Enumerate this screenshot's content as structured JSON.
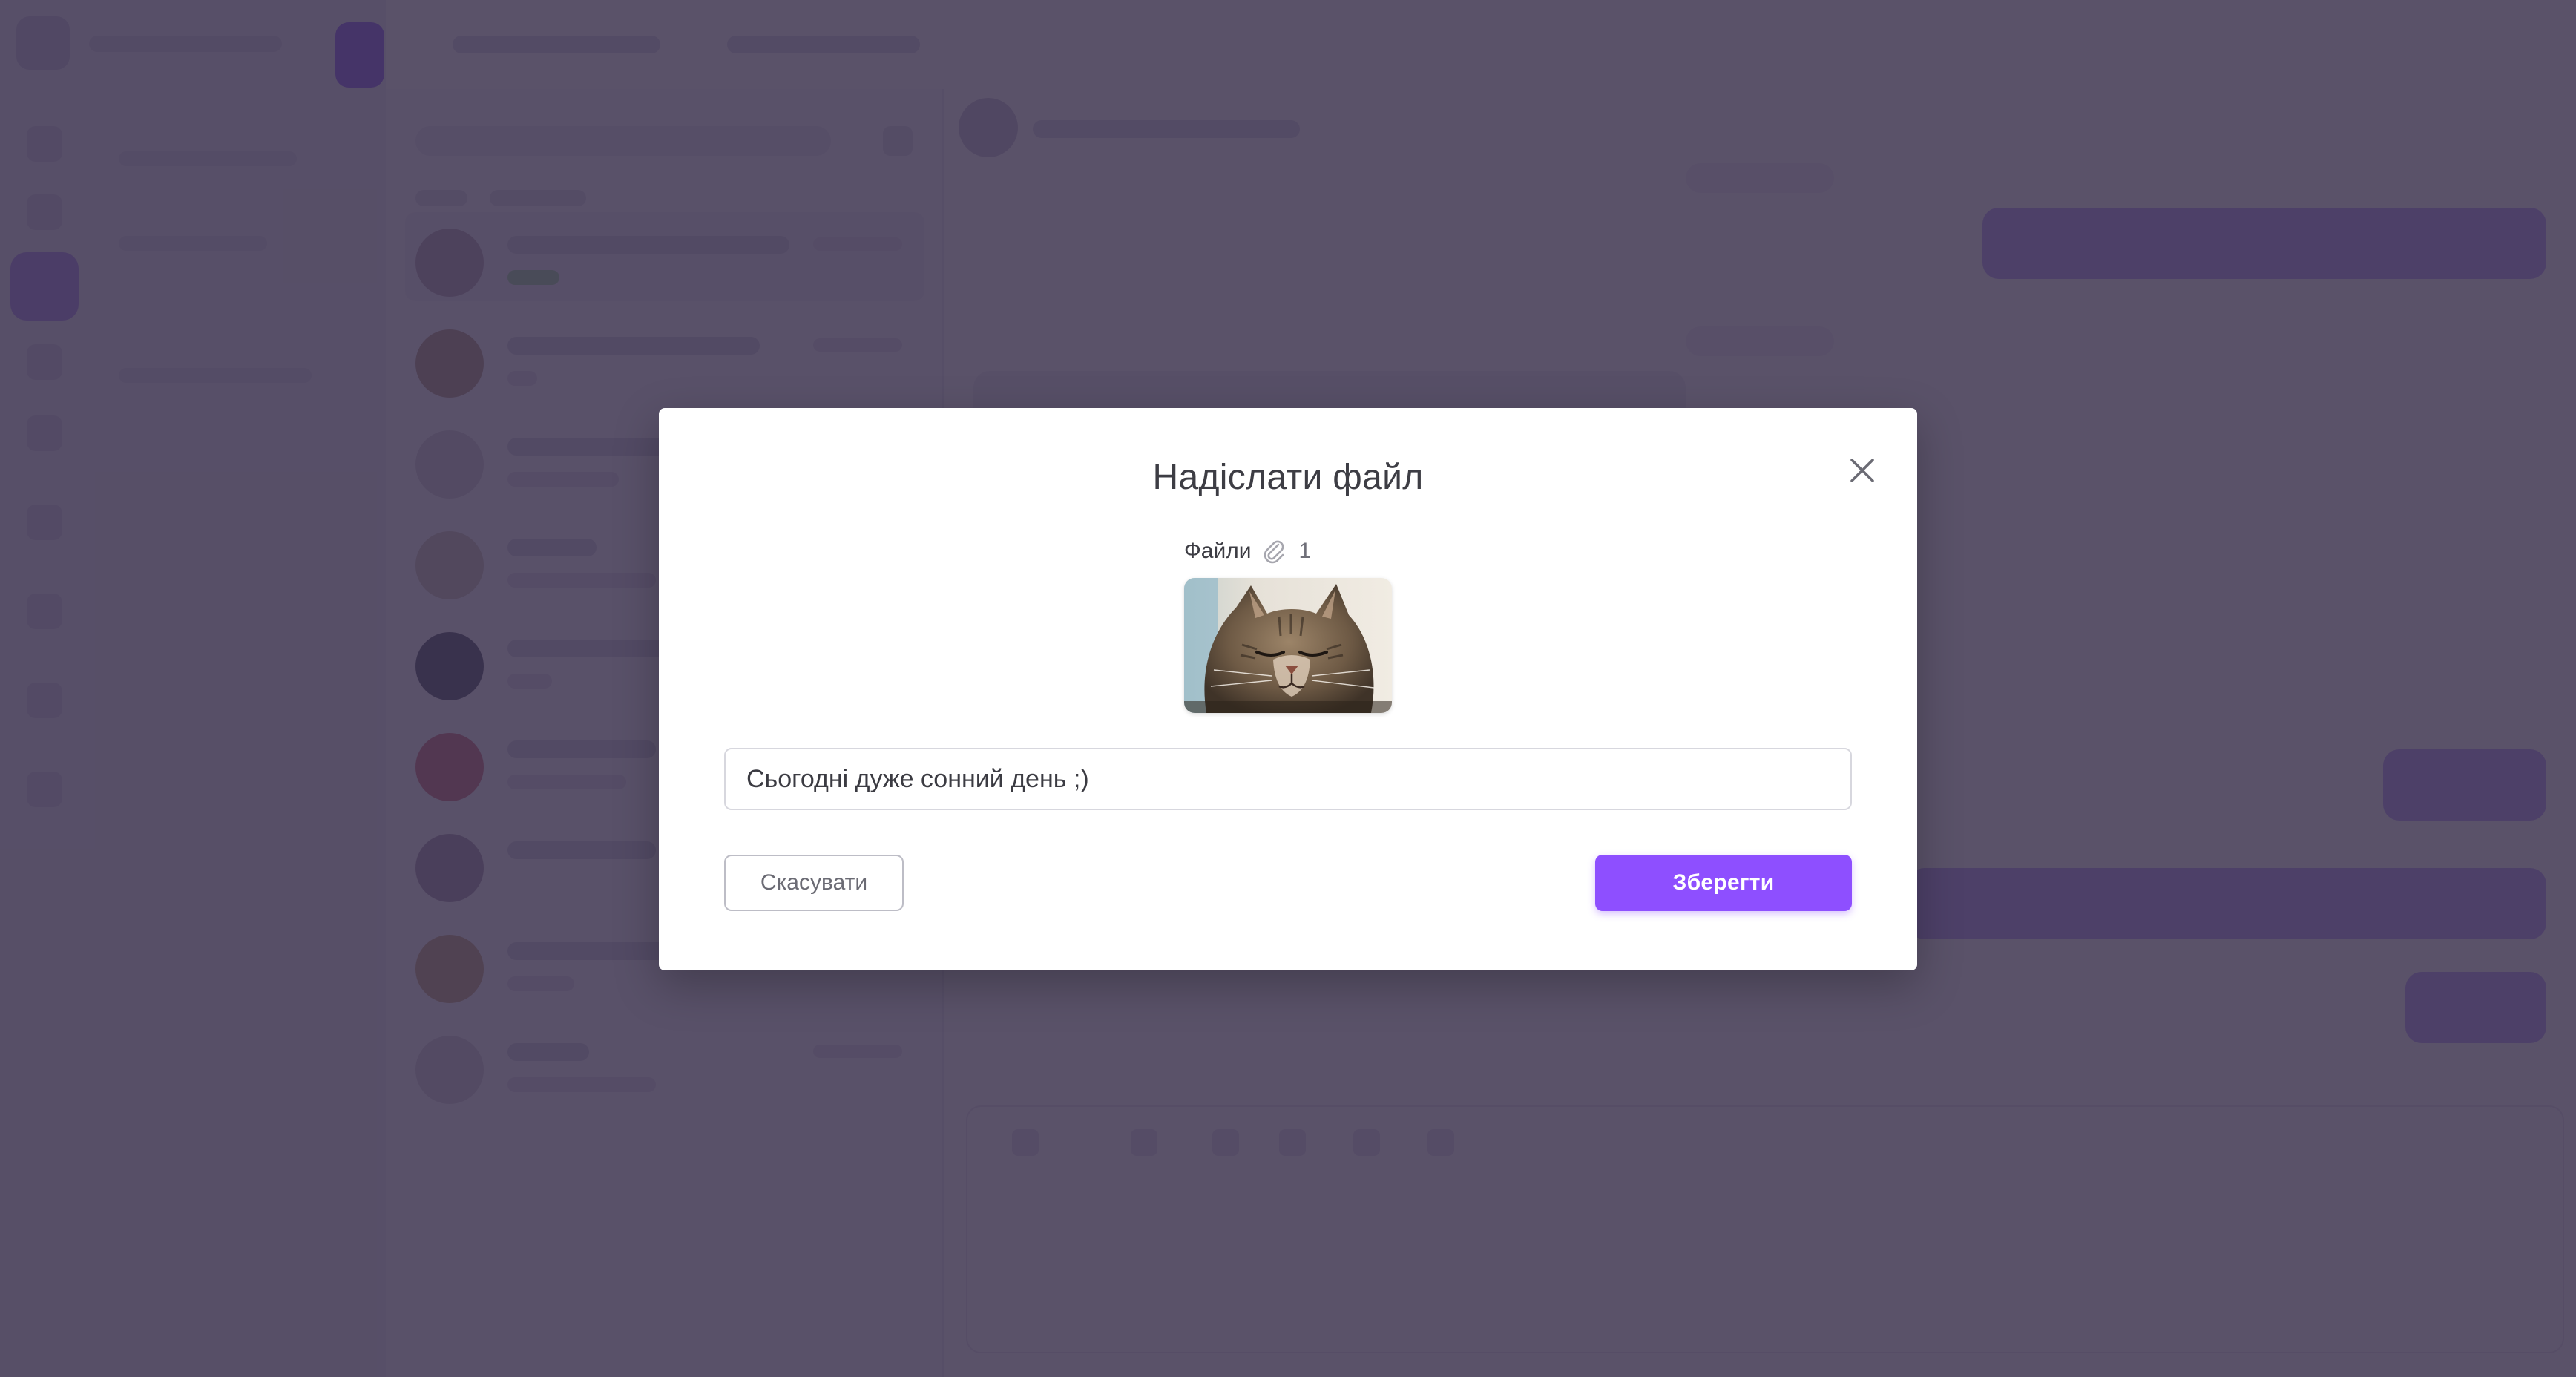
{
  "modal": {
    "title": "Надіслати файл",
    "files_label": "Файли",
    "files_count": "1",
    "attachment": {
      "kind": "image",
      "subject": "tabby cat with closed eyes"
    },
    "caption_value": "Сьогодні дуже сонний день ;)",
    "cancel_label": "Скасувати",
    "save_label": "Зберегти"
  },
  "icons": {
    "close": "close-icon",
    "attachment": "paperclip-icon"
  },
  "colors": {
    "accent": "#8e4fff",
    "overlay": "#362c48",
    "title_text": "#3d3d44"
  }
}
